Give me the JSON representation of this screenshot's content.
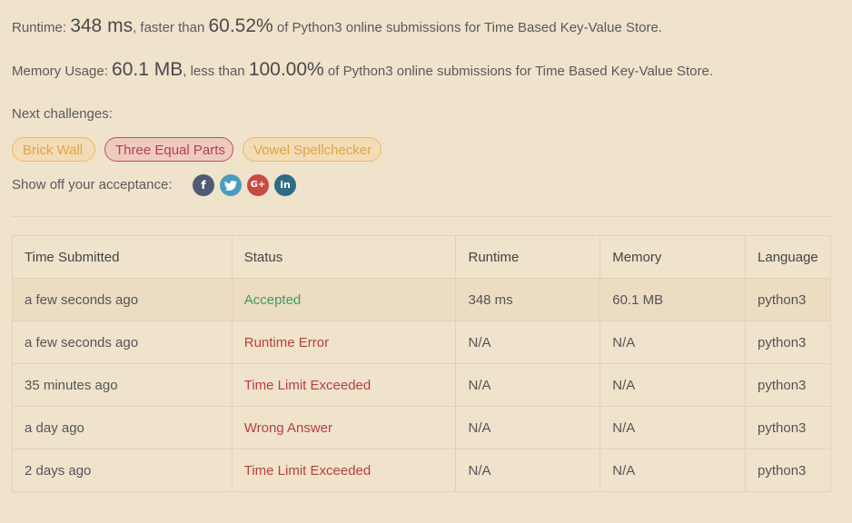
{
  "result": {
    "runtime_prefix": "Runtime: ",
    "runtime_value": "348 ms",
    "runtime_mid": ", faster than ",
    "runtime_percent": "60.52%",
    "runtime_suffix": " of Python3 online submissions for Time Based Key-Value Store.",
    "memory_prefix": "Memory Usage: ",
    "memory_value": "60.1 MB",
    "memory_mid": ", less than ",
    "memory_percent": "100.00%",
    "memory_suffix": " of Python3 online submissions for Time Based Key-Value Store."
  },
  "next": {
    "label": "Next challenges:",
    "challenges": [
      {
        "title": "Brick Wall",
        "difficulty": "easy"
      },
      {
        "title": "Three Equal Parts",
        "difficulty": "hard"
      },
      {
        "title": "Vowel Spellchecker",
        "difficulty": "easy"
      }
    ]
  },
  "share": {
    "label": "Show off your acceptance:",
    "icons": {
      "facebook": "f",
      "twitter": "🐦",
      "googleplus": "G+",
      "linkedin": "in"
    }
  },
  "table": {
    "headers": [
      "Time Submitted",
      "Status",
      "Runtime",
      "Memory",
      "Language"
    ],
    "rows": [
      {
        "time": "a few seconds ago",
        "status": "Accepted",
        "runtime": "348 ms",
        "memory": "60.1 MB",
        "language": "python3"
      },
      {
        "time": "a few seconds ago",
        "status": "Runtime Error",
        "runtime": "N/A",
        "memory": "N/A",
        "language": "python3"
      },
      {
        "time": "35 minutes ago",
        "status": "Time Limit Exceeded",
        "runtime": "N/A",
        "memory": "N/A",
        "language": "python3"
      },
      {
        "time": "a day ago",
        "status": "Wrong Answer",
        "runtime": "N/A",
        "memory": "N/A",
        "language": "python3"
      },
      {
        "time": "2 days ago",
        "status": "Time Limit Exceeded",
        "runtime": "N/A",
        "memory": "N/A",
        "language": "python3"
      }
    ]
  },
  "colors": {
    "background": "#f0e3cc",
    "accepted": "#3e9a6a",
    "error": "#b64040",
    "easy_chip": "#e0a24a",
    "hard_chip": "#b23f55"
  }
}
